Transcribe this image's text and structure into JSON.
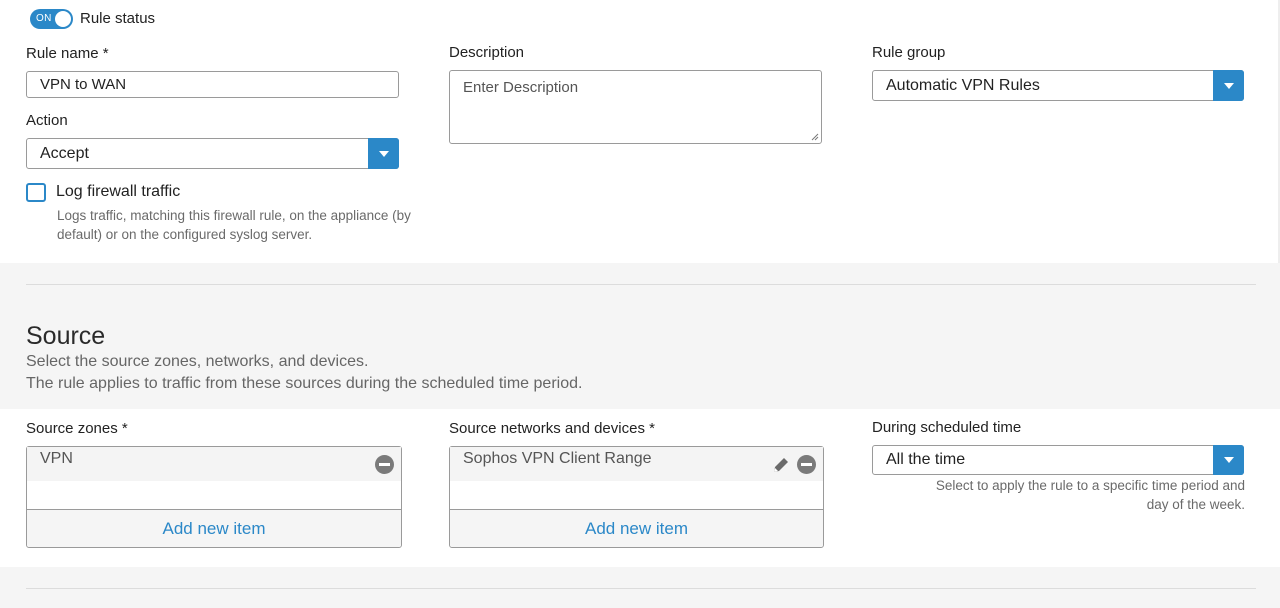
{
  "rule_status": {
    "toggle_text": "ON",
    "label": "Rule status"
  },
  "rule_name": {
    "label": "Rule name *",
    "value": "VPN to WAN"
  },
  "description": {
    "label": "Description",
    "placeholder": "Enter Description"
  },
  "rule_group": {
    "label": "Rule group",
    "value": "Automatic VPN Rules"
  },
  "action": {
    "label": "Action",
    "value": "Accept"
  },
  "log_traffic": {
    "label": "Log firewall traffic",
    "help_line1": "Logs traffic, matching this firewall rule, on the appliance (by",
    "help_line2": "default) or on the configured syslog server."
  },
  "source": {
    "title": "Source",
    "desc_line1": "Select the source zones, networks, and devices.",
    "desc_line2": "The rule applies to traffic from these sources during the scheduled time period."
  },
  "source_zones": {
    "label": "Source zones *",
    "items": [
      "VPN"
    ],
    "add_label": "Add new item"
  },
  "source_networks": {
    "label": "Source networks and devices *",
    "items": [
      "Sophos VPN Client Range"
    ],
    "add_label": "Add new item"
  },
  "schedule": {
    "label": "During scheduled time",
    "value": "All the time",
    "help_line1": "Select to apply the rule to a specific time period and",
    "help_line2": "day of the week."
  },
  "colors": {
    "accent": "#2b88c8",
    "panel": "#ffffff",
    "background": "#f5f5f5"
  },
  "icons": {
    "remove": "minus-circle-icon",
    "edit": "pencil-icon",
    "dropdown": "caret-down-icon"
  }
}
